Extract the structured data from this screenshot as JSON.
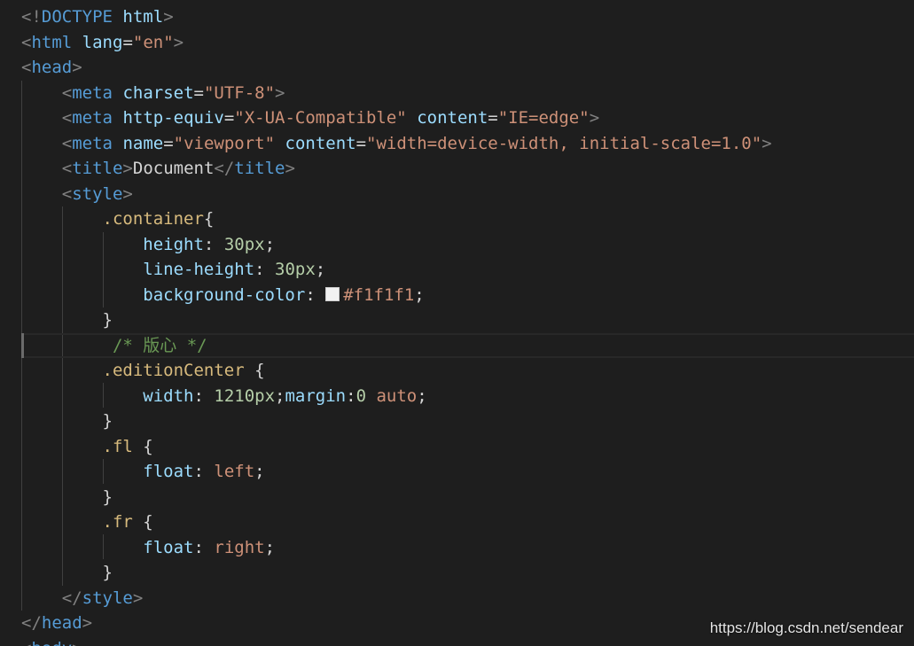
{
  "code": {
    "doctype_open": "<!",
    "doctype_kw": "DOCTYPE",
    "doctype_name": "html",
    "html_tag": "html",
    "lang_attr": "lang",
    "lang_val": "\"en\"",
    "head_tag": "head",
    "meta_tag": "meta",
    "charset_attr": "charset",
    "charset_val": "\"UTF-8\"",
    "http_equiv_attr": "http-equiv",
    "http_equiv_val": "\"X-UA-Compatible\"",
    "content_attr": "content",
    "ie_edge_val": "\"IE=edge\"",
    "name_attr": "name",
    "viewport_val": "\"viewport\"",
    "viewport_content_val": "\"width=device-width, initial-scale=1.0\"",
    "title_tag": "title",
    "title_text": "Document",
    "style_tag": "style",
    "container_sel": ".container",
    "height_prop": "height",
    "line_height_prop": "line-height",
    "px30": "30px",
    "bg_prop": "background-color",
    "bg_val": "#f1f1f1",
    "comment": "/* 版心 */",
    "edition_sel": ".editionCenter",
    "width_prop": "width",
    "width_val": "1210px",
    "margin_prop": "margin",
    "zero": "0",
    "auto": "auto",
    "fl_sel": ".fl",
    "fr_sel": ".fr",
    "float_prop": "float",
    "left": "left",
    "right": "right",
    "body_tag": "body"
  },
  "colors": {
    "background": "#1e1e1e",
    "tag": "#569cd6",
    "attribute": "#9cdcfe",
    "string": "#ce9178",
    "selector": "#d7ba7d",
    "number": "#b5cea8",
    "comment": "#6a9955",
    "bracket": "#808080",
    "swatch": "#f1f1f1"
  },
  "watermark": "https://blog.csdn.net/sendear"
}
